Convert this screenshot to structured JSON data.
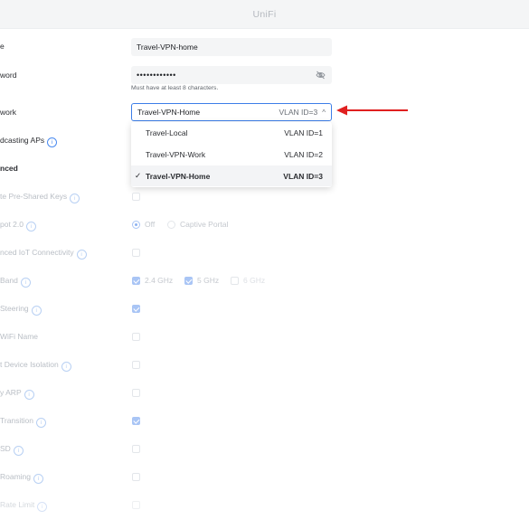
{
  "app": {
    "title": "UniFi"
  },
  "labels": {
    "name": "e",
    "password": "word",
    "network": "work",
    "broadcasting_aps": "dcasting APs",
    "advanced": "nced",
    "private_keys": "te Pre-Shared Keys",
    "hotspot": "pot 2.0",
    "iot": "nced IoT Connectivity",
    "band": "Band",
    "band_steering": "Steering",
    "hide_wifi": "WiFi Name",
    "client_isolation": "t Device Isolation",
    "proxy_arp": "y ARP",
    "bss_transition": "Transition",
    "uapsd": "SD",
    "fast_roaming": "Roaming",
    "multicast": "Rate Limit"
  },
  "form": {
    "name_value": "Travel-VPN-home",
    "password_value": "••••••••••••",
    "password_hint": "Must have at least 8 characters.",
    "network_selected": "Travel-VPN-Home",
    "network_selected_vlan": "VLAN ID=3",
    "network_options": [
      {
        "label": "Travel-Local",
        "vlan": "VLAN ID=1"
      },
      {
        "label": "Travel-VPN-Work",
        "vlan": "VLAN ID=2"
      },
      {
        "label": "Travel-VPN-Home",
        "vlan": "VLAN ID=3",
        "check": "✓"
      }
    ],
    "hotspot_off": "Off",
    "hotspot_captive": "Captive Portal",
    "band_24": "2.4 GHz",
    "band_5": "5 GHz",
    "band_6": "6 GHz"
  },
  "icons": {
    "info": "i",
    "chevron": "^"
  },
  "colors": {
    "accent": "#3d7ee8",
    "arrow": "#e02020"
  }
}
